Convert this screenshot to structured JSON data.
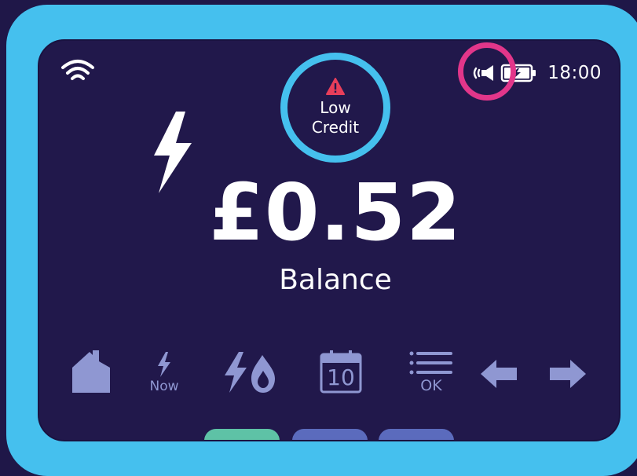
{
  "colors": {
    "frame": "#45c0ee",
    "screen": "#21184b",
    "highlight_ring": "#e2368a",
    "alert_icon": "#e83e5a",
    "nav_icon": "#8f97d2",
    "tab_active": "#5ec2a6",
    "tab_inactive": "#5b6bbd"
  },
  "status": {
    "wifi_icon": "wifi-icon",
    "speaker_icon": "speaker-icon",
    "battery_icon": "battery-charging-icon",
    "time": "18:00"
  },
  "alert": {
    "icon": "warning-icon",
    "line1": "Low",
    "line2": "Credit"
  },
  "meter": {
    "icon": "electricity-bolt-icon",
    "balance": "£0.52",
    "label": "Balance"
  },
  "nav": {
    "home": {
      "icon": "home-icon"
    },
    "now": {
      "icon": "bolt-icon",
      "label": "Now"
    },
    "dual_fuel": {
      "icon": "electricity-gas-icon"
    },
    "calendar": {
      "icon": "calendar-icon",
      "day": "10"
    },
    "menu": {
      "icon": "list-icon",
      "label": "OK"
    },
    "back": {
      "icon": "arrow-left-icon"
    },
    "forward": {
      "icon": "arrow-right-icon"
    }
  },
  "tabs": [
    {
      "state": "active"
    },
    {
      "state": "inactive"
    },
    {
      "state": "inactive"
    }
  ]
}
